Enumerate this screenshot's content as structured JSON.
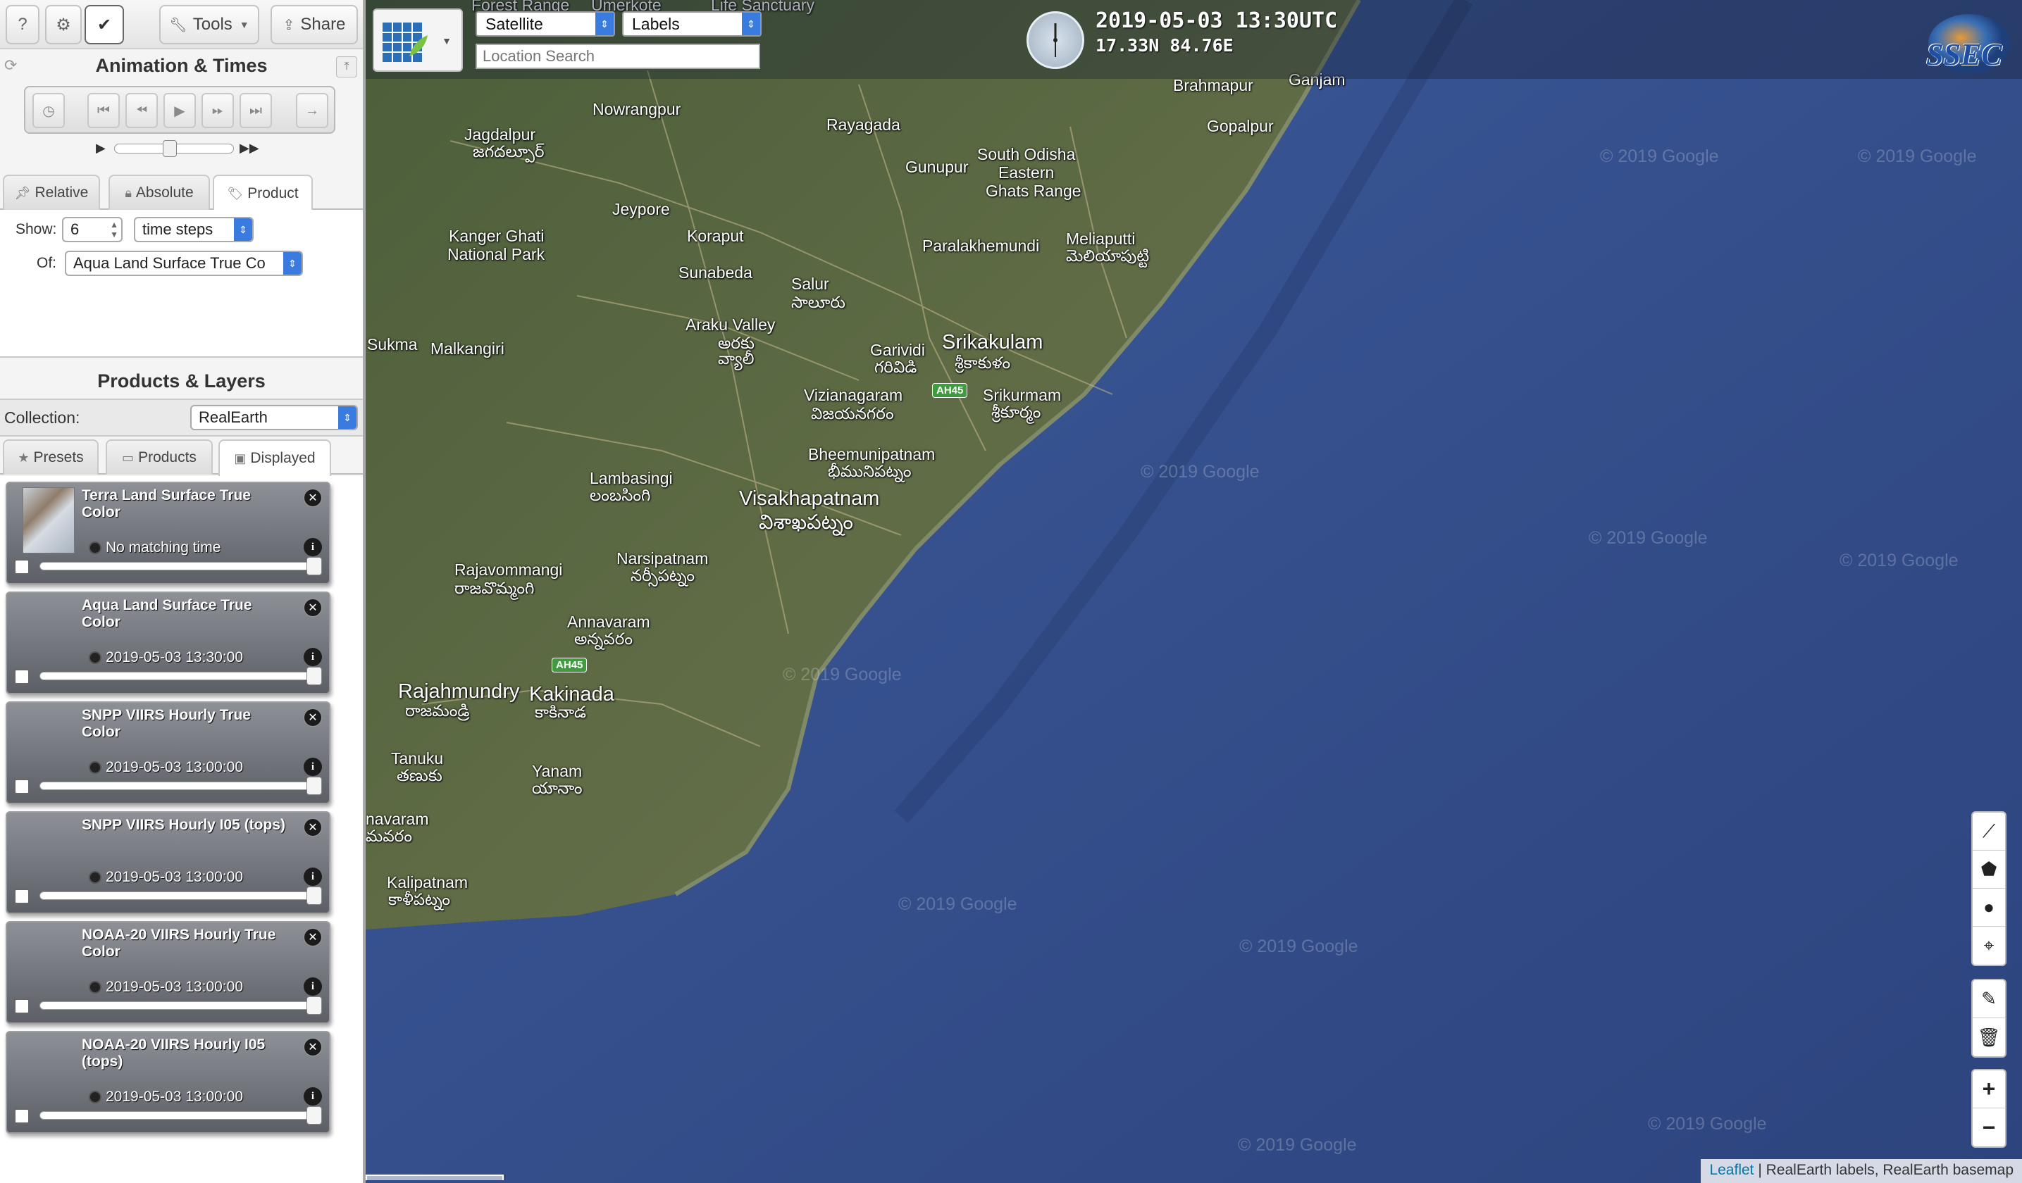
{
  "toolbar": {
    "help_label": "?",
    "settings_label": "⚙",
    "check_label": "✔",
    "tools_label": "Tools",
    "share_label": "Share"
  },
  "animation": {
    "title": "Animation & Times",
    "controls": [
      "clock-button",
      "first-frame",
      "step-back",
      "play",
      "step-forward",
      "last-frame",
      "forward-arrow"
    ]
  },
  "time_tabs": [
    {
      "label": "Relative",
      "icon": "pin-icon",
      "active": false
    },
    {
      "label": "Absolute",
      "icon": "lock-icon",
      "active": false
    },
    {
      "label": "Product",
      "icon": "tag-icon",
      "active": true
    }
  ],
  "product_form": {
    "show_label": "Show:",
    "show_value": "6",
    "unit_value": "time steps",
    "of_label": "Of:",
    "of_value": "Aqua Land Surface True Co"
  },
  "products": {
    "title": "Products & Layers",
    "collection_label": "Collection:",
    "collection_value": "RealEarth",
    "tabs": [
      {
        "label": "Presets",
        "icon": "star-icon",
        "active": false
      },
      {
        "label": "Products",
        "icon": "folder-icon",
        "active": false
      },
      {
        "label": "Displayed",
        "icon": "image-icon",
        "active": true
      }
    ]
  },
  "layers": [
    {
      "title": "Terra Land Surface True Color",
      "time": "No matching time",
      "has_thumb": true
    },
    {
      "title": "Aqua Land Surface True Color",
      "time": "2019-05-03 13:30:00",
      "has_thumb": false
    },
    {
      "title": "SNPP VIIRS Hourly True Color",
      "time": "2019-05-03 13:00:00",
      "has_thumb": false
    },
    {
      "title": "SNPP VIIRS Hourly I05 (tops)",
      "time": "2019-05-03 13:00:00",
      "has_thumb": false
    },
    {
      "title": "NOAA-20 VIIRS Hourly True Color",
      "time": "2019-05-03 13:00:00",
      "has_thumb": false
    },
    {
      "title": "NOAA-20 VIIRS Hourly I05 (tops)",
      "time": "2019-05-03 13:00:00",
      "has_thumb": false
    }
  ],
  "map": {
    "basemap_value": "Satellite",
    "labels_value": "Labels",
    "search_placeholder": "Location Search",
    "datetime": "2019-05-03 13:30UTC",
    "coordinate": "17.33N 84.76E",
    "logo_text": "SSEC",
    "places": [
      "Forest Range",
      "Umerkote",
      "Life Sanctuary",
      "Ganjam",
      "Brahmapur",
      "Gopalpur",
      "Nowrangpur",
      "Rayagada",
      "Jagdalpur",
      "జగదల్పూర్",
      "Gunupur",
      "South Odisha",
      "Eastern",
      "Ghats Range",
      "Jeypore",
      "Koraput",
      "Paralakhemundi",
      "Meliaputti",
      "మెలియాపుట్టి",
      "Kanger Ghati",
      "National Park",
      "Sunabeda",
      "Salur",
      "సాలూరు",
      "Sukma",
      "Malkangiri",
      "Araku Valley",
      "అరకు",
      "వ్యాలీ",
      "Garividi",
      "గరివిడి",
      "Srikakulam",
      "శ్రీకాకుళం",
      "Vizianagaram",
      "విజయనగరం",
      "Srikurmam",
      "శ్రీకూర్మం",
      "Bheemunipatnam",
      "భీమునిపట్నం",
      "Lambasingi",
      "లంబసింగి",
      "Visakhapatnam",
      "విశాఖపట్నం",
      "Rajavommangi",
      "రాజవొమ్మంగి",
      "Narsipatnam",
      "నర్సీపట్నం",
      "Annavaram",
      "అన్నవరం",
      "Rajahmundry",
      "రాజమండ్రి",
      "Kakinada",
      "కాకినాడ",
      "Tanuku",
      "తణుకు",
      "Yanam",
      "యానాం",
      "navaram",
      "మవరం",
      "Kalipatnam",
      "కాళీపట్నం"
    ],
    "highway_shields": [
      "AH45",
      "AH45"
    ],
    "watermark": "© 2019 Google",
    "controls": [
      "polyline-icon",
      "polygon-icon",
      "circle-icon",
      "marker-icon",
      "edit-icon",
      "trash-icon",
      "zoom-in-icon",
      "zoom-out-icon"
    ],
    "zoom_in_label": "+",
    "zoom_out_label": "−",
    "attribution_link": "Leaflet",
    "attribution_text": " | RealEarth labels, RealEarth basemap"
  }
}
